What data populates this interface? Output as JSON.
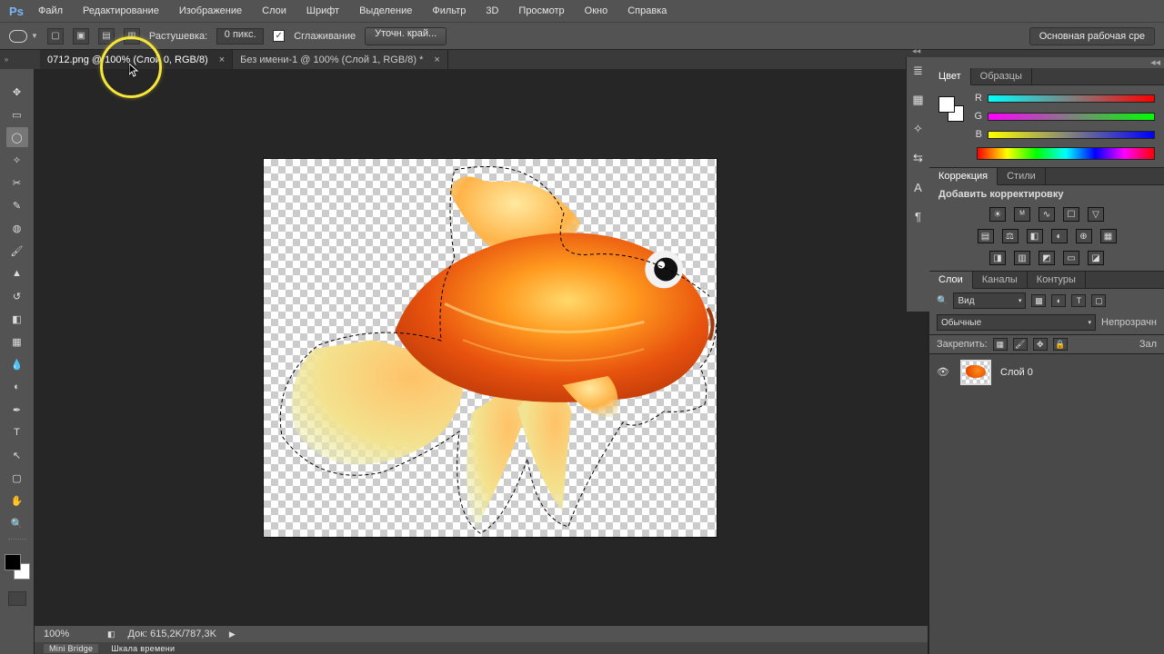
{
  "menu": {
    "items": [
      "Файл",
      "Редактирование",
      "Изображение",
      "Слои",
      "Шрифт",
      "Выделение",
      "Фильтр",
      "3D",
      "Просмотр",
      "Окно",
      "Справка"
    ]
  },
  "options": {
    "feather_label": "Растушевка:",
    "feather_value": "0 пикс.",
    "antialias_label": "Сглаживание",
    "refine_label": "Уточн. край...",
    "workspace": "Основная рабочая сре"
  },
  "tabs": [
    {
      "label": "0712.png @ 100% (Слой 0, RGB/8)",
      "active": true
    },
    {
      "label": "Без имени-1 @ 100% (Слой 1, RGB/8) *",
      "active": false
    }
  ],
  "panels": {
    "color_tab": "Цвет",
    "swatches_tab": "Образцы",
    "rgb": {
      "r": "R",
      "g": "G",
      "b": "B"
    },
    "adjustments_tab": "Коррекция",
    "styles_tab": "Стили",
    "add_adjustment": "Добавить корректировку",
    "layers_tab": "Слои",
    "channels_tab": "Каналы",
    "paths_tab": "Контуры",
    "filter_kind": "Вид",
    "blend_mode": "Обычные",
    "opacity_label": "Непрозрачн",
    "lock_label": "Закрепить:",
    "fill_label": "Зал",
    "layer0_name": "Слой 0"
  },
  "status": {
    "zoom": "100%",
    "doc": "Док: 615,2K/787,3K"
  },
  "bottom_tabs": {
    "mini": "Mini Bridge",
    "timeline": "Шкала времени"
  }
}
